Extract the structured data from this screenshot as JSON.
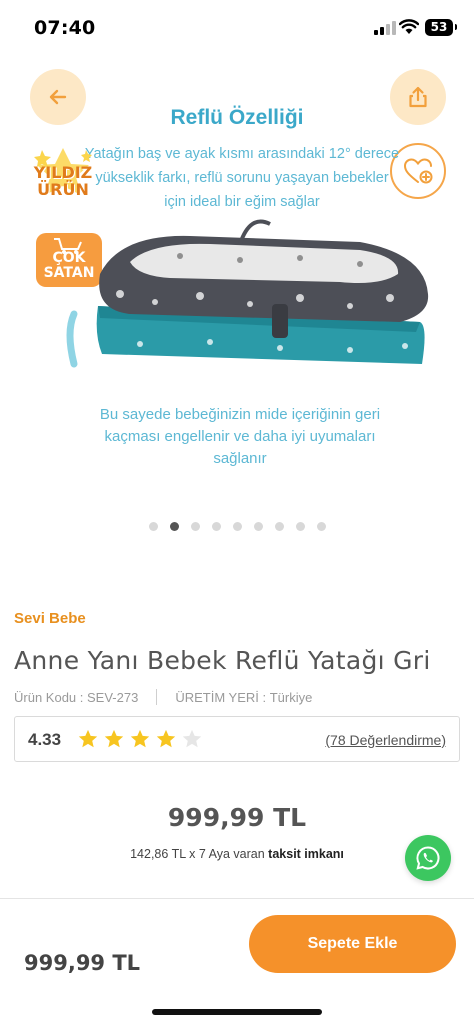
{
  "status_bar": {
    "time": "07:40",
    "battery": "53"
  },
  "hero": {
    "title": "Reflü Özelliği",
    "description_top": "Yatağın baş ve ayak kısmı arasındaki 12° derece yükseklik farkı, reflü sorunu yaşayan bebekler için ideal bir eğim sağlar",
    "description_bottom": "Bu sayede bebeğinizin mide içeriğinin geri kaçması engellenir ve daha iyi uyumaları sağlanır",
    "badge_star": [
      "YILDIZ",
      "ÜRÜN"
    ],
    "badge_sale": [
      "ÇOK",
      "SATAN"
    ],
    "carousel": {
      "total": 9,
      "active_index": 1
    },
    "icons": {
      "back": "arrow-left-icon",
      "share": "share-icon",
      "favorite": "heart-plus-icon"
    }
  },
  "product": {
    "brand": "Sevi Bebe",
    "title": "Anne Yanı Bebek Reflü Yatağı Gri",
    "code_label": "Ürün Kodu :",
    "code_value": "SEV-273",
    "origin_label": "ÜRETİM YERİ :",
    "origin_value": "Türkiye",
    "rating": "4.33",
    "rating_stars_filled": 4,
    "rating_stars_total": 5,
    "reviews": "(78 Değerlendirme)",
    "price": "999,99 TL",
    "installment_text": "142,86 TL x 7 Aya varan",
    "installment_bold": "taksit imkanı"
  },
  "bottom_bar": {
    "price": "999,99 TL",
    "cart_button": "Sepete Ekle"
  },
  "colors": {
    "accent_orange": "#f5912a",
    "brand_orange": "#e8901f",
    "hero_blue": "#3ba8c9",
    "whatsapp_green": "#3cc760",
    "star_yellow": "#f7c520"
  }
}
